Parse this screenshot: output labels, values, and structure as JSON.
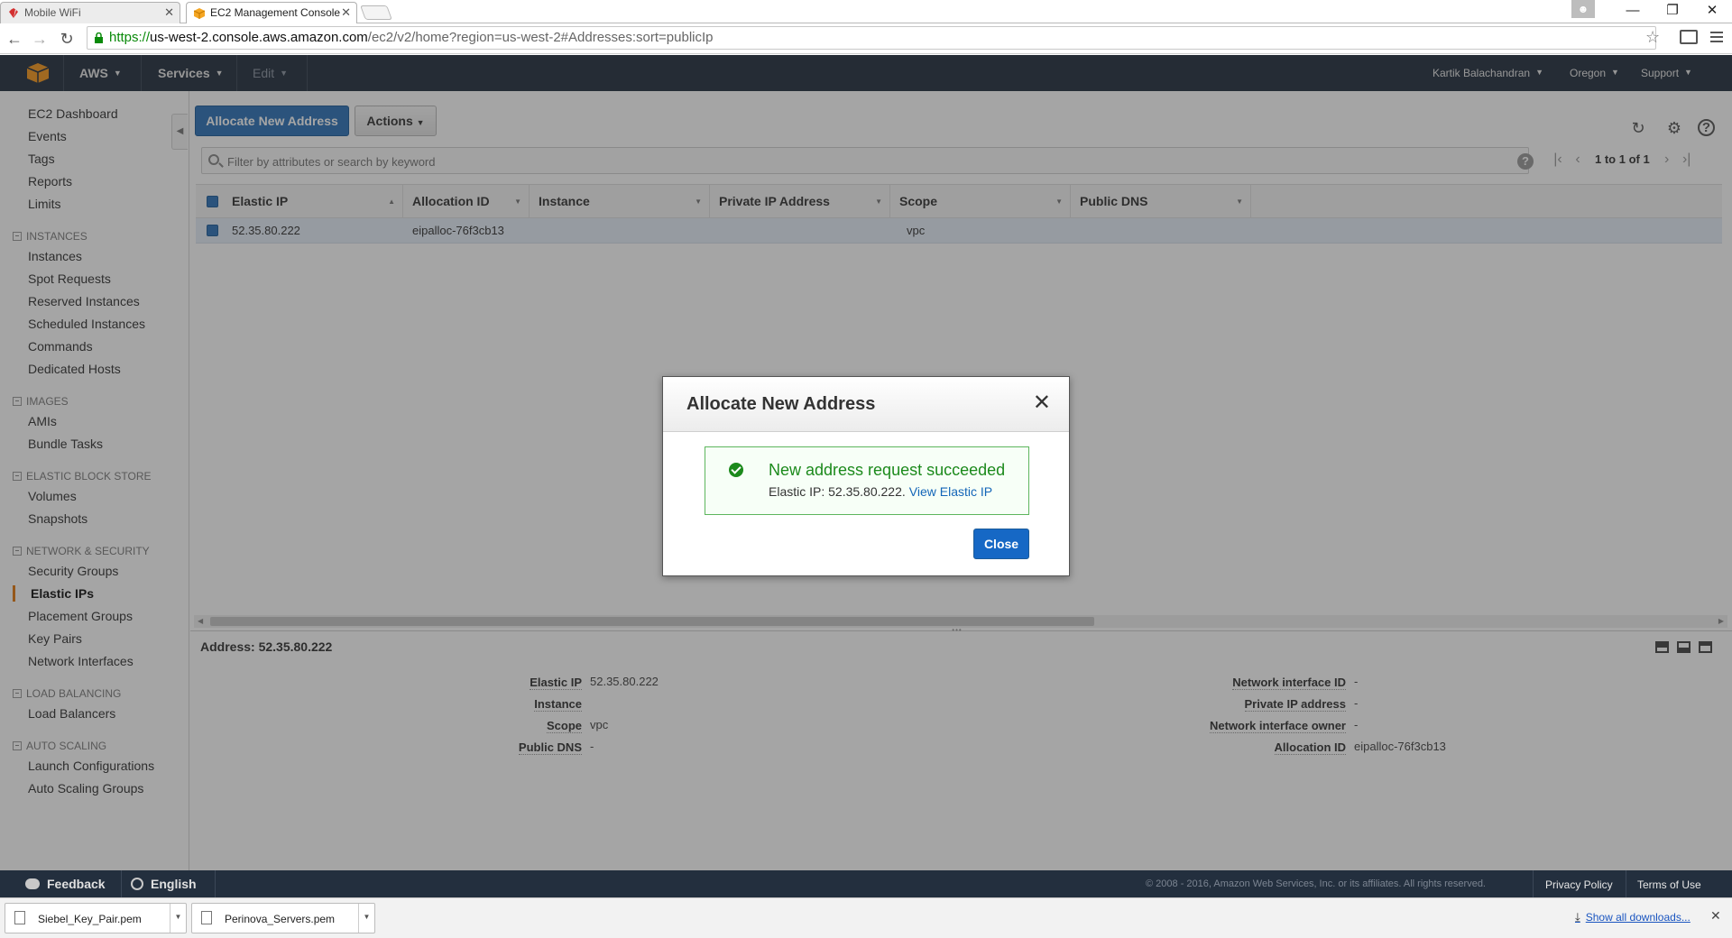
{
  "browser": {
    "tabs": [
      {
        "title": "Mobile WiFi",
        "close": "✕"
      },
      {
        "title": "EC2 Management Console",
        "close": "✕"
      }
    ],
    "url": {
      "protocol": "https://",
      "host": "us-west-2.console.aws.amazon.com",
      "path": "/ec2/v2/home?region=us-west-2#Addresses:sort=publicIp"
    }
  },
  "aws_nav": {
    "aws_label": "AWS",
    "services_label": "Services",
    "edit_label": "Edit",
    "user": "Kartik Balachandran",
    "region": "Oregon",
    "support": "Support"
  },
  "sidebar": {
    "top_links": [
      "EC2 Dashboard",
      "Events",
      "Tags",
      "Reports",
      "Limits"
    ],
    "sections": [
      {
        "title": "INSTANCES",
        "links": [
          "Instances",
          "Spot Requests",
          "Reserved Instances",
          "Scheduled Instances",
          "Commands",
          "Dedicated Hosts"
        ]
      },
      {
        "title": "IMAGES",
        "links": [
          "AMIs",
          "Bundle Tasks"
        ]
      },
      {
        "title": "ELASTIC BLOCK STORE",
        "links": [
          "Volumes",
          "Snapshots"
        ]
      },
      {
        "title": "NETWORK & SECURITY",
        "links": [
          "Security Groups",
          "Elastic IPs",
          "Placement Groups",
          "Key Pairs",
          "Network Interfaces"
        ]
      },
      {
        "title": "LOAD BALANCING",
        "links": [
          "Load Balancers"
        ]
      },
      {
        "title": "AUTO SCALING",
        "links": [
          "Launch Configurations",
          "Auto Scaling Groups"
        ]
      }
    ],
    "active_item": "Elastic IPs"
  },
  "toolbar": {
    "allocate_label": "Allocate New Address",
    "actions_label": "Actions"
  },
  "filter": {
    "placeholder": "Filter by attributes or search by keyword",
    "help": "?"
  },
  "pagination": {
    "text": "1 to 1 of 1"
  },
  "table": {
    "columns": [
      "Elastic IP",
      "Allocation ID",
      "Instance",
      "Private IP Address",
      "Scope",
      "Public DNS"
    ],
    "rows": [
      {
        "elastic_ip": "52.35.80.222",
        "allocation_id": "eipalloc-76f3cb13",
        "instance": "",
        "private_ip": "",
        "scope": "vpc",
        "public_dns": ""
      }
    ]
  },
  "details": {
    "title": "Address: 52.35.80.222",
    "left": [
      {
        "label": "Elastic IP",
        "value": "52.35.80.222"
      },
      {
        "label": "Instance",
        "value": ""
      },
      {
        "label": "Scope",
        "value": "vpc"
      },
      {
        "label": "Public DNS",
        "value": "-"
      }
    ],
    "right": [
      {
        "label": "Network interface ID",
        "value": "-"
      },
      {
        "label": "Private IP address",
        "value": "-"
      },
      {
        "label": "Network interface owner",
        "value": "-"
      },
      {
        "label": "Allocation ID",
        "value": "eipalloc-76f3cb13"
      }
    ]
  },
  "modal": {
    "title": "Allocate New Address",
    "success_title": "New address request succeeded",
    "success_detail": "Elastic IP: 52.35.80.222.",
    "view_link": "View Elastic IP",
    "close_label": "Close"
  },
  "footer": {
    "feedback": "Feedback",
    "language": "English",
    "copyright": "© 2008 - 2016, Amazon Web Services, Inc. or its affiliates. All rights reserved.",
    "privacy": "Privacy Policy",
    "terms": "Terms of Use"
  },
  "downloads": {
    "files": [
      "Siebel_Key_Pair.pem",
      "Perinova_Servers.pem"
    ],
    "show_all": "Show all downloads..."
  },
  "colors": {
    "aws_nav_bg": "#232f3e",
    "primary_button": "#2e73b8",
    "active_accent": "#e47911",
    "success_green": "#1c8a1c"
  }
}
